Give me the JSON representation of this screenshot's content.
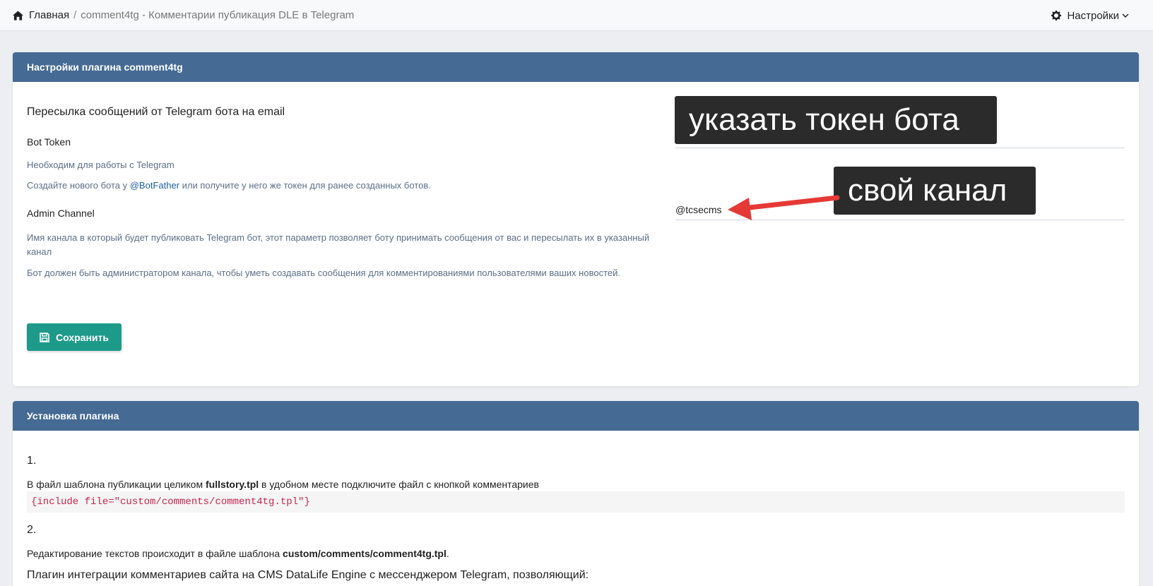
{
  "breadcrumb": {
    "home_label": "Главная",
    "separator": "/",
    "current": "comment4tg - Комментарии публикация DLE в Telegram"
  },
  "settings_menu": {
    "label": "Настройки"
  },
  "settings_panel": {
    "header": "Настройки плагина comment4tg",
    "title": "Пересылка сообщений от Telegram бота на email",
    "bot_token": {
      "label": "Bot Token",
      "hint1": "Необходим для работы с Telegram",
      "hint2_before": "Создайте нового бота у ",
      "hint2_link": "@BotFather",
      "hint2_after": " или получите у него же токен для ранее созданных ботов.",
      "value": ""
    },
    "admin_channel": {
      "label": "Admin Channel",
      "hint1": "Имя канала в который будет публиковать Telegram бот, этот параметр позволяет боту принимать сообщения от вас и пересылать их в указанный канал",
      "hint2": "Бот должен быть администратором канала, чтобы уметь создавать сообщения для комментированиями пользователями ваших новостей.",
      "value": "@tcsecms"
    },
    "save_label": "Сохранить"
  },
  "annotations": {
    "token": "указать токен бота",
    "channel": "свой канал",
    "arrow_color": "#e53935"
  },
  "install_panel": {
    "header": "Установка плагина",
    "step1_num": "1.",
    "step1_before": "В файл шаблона публикации целиком ",
    "step1_bold": "fullstory.tpl",
    "step1_after": " в удобном месте подключите файл с кнопкой комментариев",
    "code": "{include file=\"custom/comments/comment4tg.tpl\"}",
    "step2_num": "2.",
    "step2_before": "Редактирование текстов происходит в файле шаблона ",
    "step2_bold": "custom/comments/comment4tg.tpl",
    "step2_after": ".",
    "description": "Плагин интеграции комментариев сайта на CMS DataLife Engine с мессенджером Telegram, позволяющий:"
  },
  "colors": {
    "panel_header": "#456a93",
    "save_button": "#1e9a8a",
    "link": "#1d5fa0",
    "code_text": "#c7254e"
  }
}
